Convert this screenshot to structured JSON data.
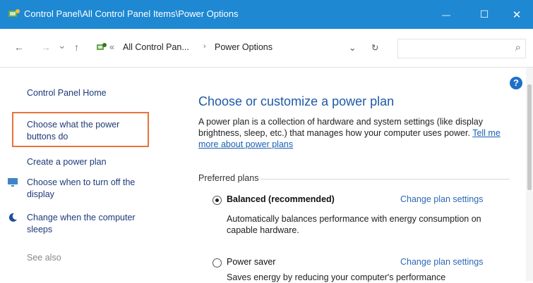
{
  "window": {
    "title": "Control Panel\\All Control Panel Items\\Power Options",
    "minimize": "—",
    "maximize": "☐",
    "close": "✕",
    "title_icon": "control-panel-icon"
  },
  "address": {
    "back": "←",
    "forward": "→",
    "recent": "⌄",
    "up": "↑",
    "prefix": "«",
    "crumbs": [
      "All Control Pan...",
      "Power Options"
    ],
    "separator": "›",
    "dropdown": "⌄",
    "refresh": "↻",
    "search_icon": "⌕"
  },
  "sidebar": {
    "home": "Control Panel Home",
    "power_buttons": "Choose what the power buttons do",
    "create_plan": "Create a power plan",
    "turn_off_display": "Choose when to turn off the display",
    "sleep": "Change when the computer sleeps",
    "see_also": "See also"
  },
  "main": {
    "heading": "Choose or customize a power plan",
    "desc": "A power plan is a collection of hardware and system settings (like display brightness, sleep, etc.) that manages how your computer uses power.",
    "desc_link": "Tell me more about power plans",
    "section": "Preferred plans",
    "plans": [
      {
        "name": "Balanced (recommended)",
        "link": "Change plan settings",
        "desc": "Automatically balances performance with energy consumption on capable hardware.",
        "selected": true
      },
      {
        "name": "Power saver",
        "link": "Change plan settings",
        "desc": "Saves energy by reducing your computer's performance",
        "selected": false
      }
    ]
  },
  "help": "?",
  "colors": {
    "titlebar": "#1e88d2",
    "link": "#1e3a78",
    "heading": "#1d5aa6",
    "highlight": "#e8733a"
  }
}
